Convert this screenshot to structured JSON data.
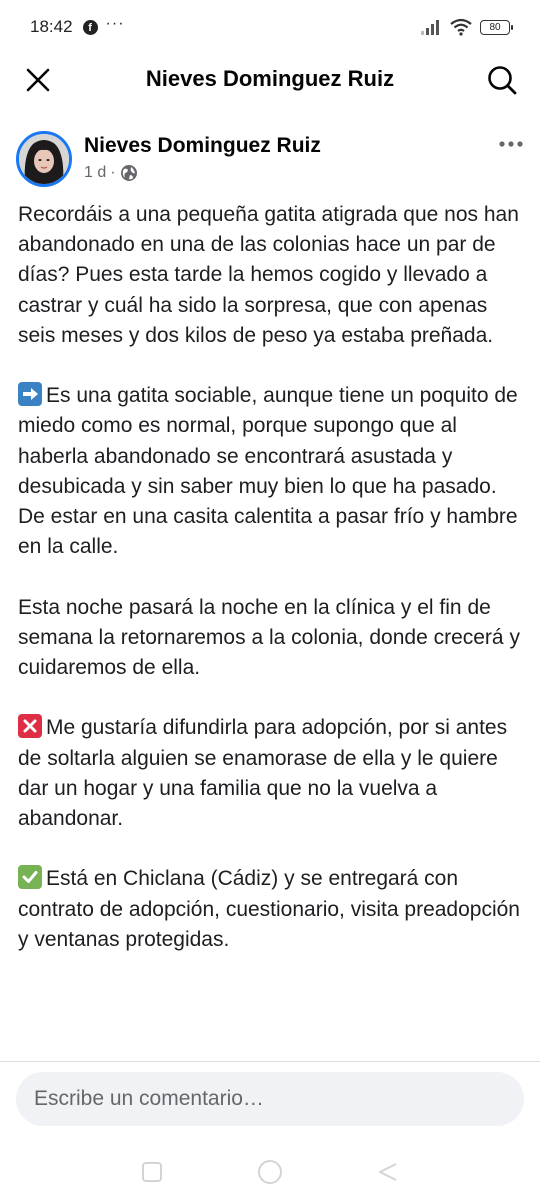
{
  "status_bar": {
    "time": "18:42",
    "facebook_icon": "facebook-icon",
    "more_notifications": "···",
    "battery": "80",
    "icons": [
      "signal-icon",
      "wifi-icon",
      "battery-icon"
    ]
  },
  "header": {
    "title": "Nieves Dominguez Ruiz",
    "close_icon": "close-icon",
    "search_icon": "search-icon"
  },
  "post": {
    "author": "Nieves Dominguez Ruiz",
    "time": "1 d",
    "separator": "·",
    "privacy_icon": "globe-icon",
    "more_icon": "more-options-icon",
    "paragraphs": [
      {
        "emoji": "",
        "text": "Recordáis a una pequeña gatita atigrada que nos han abandonado en una de las colonias hace un par de días? Pues esta tarde la hemos cogido y llevado a castrar y cuál ha sido la sorpresa, que con apenas seis meses y dos kilos de peso ya estaba preñada."
      },
      {
        "emoji": "arrow-right-emoji",
        "text": "Es una gatita sociable, aunque tiene un poquito de miedo como es normal, porque supongo que al haberla abandonado se encontrará asustada y desubicada y sin saber muy bien lo que ha pasado. De estar en una casita calentita a pasar frío y hambre en la calle."
      },
      {
        "emoji": "",
        "text": "Esta noche pasará la noche en la clínica y el fin de semana la retornaremos a la colonia, donde crecerá y cuidaremos de ella."
      },
      {
        "emoji": "cross-mark-emoji",
        "text": "Me gustaría difundirla para adopción, por si antes de soltarla alguien se enamorase de ella y le quiere dar un hogar y una familia que no la vuelva a abandonar."
      },
      {
        "emoji": "check-mark-emoji",
        "text": "Está en Chiclana (Cádiz) y se entregará con contrato de adopción, cuestionario, visita preadopción y ventanas protegidas."
      }
    ]
  },
  "comment": {
    "placeholder": "Escribe un comentario…"
  },
  "nav": {
    "icons": [
      "recent-apps-icon",
      "home-icon",
      "back-icon"
    ]
  },
  "colors": {
    "accent": "#1877f2",
    "text": "#1c1e21",
    "muted": "#65676b",
    "input_bg": "#f0f2f5"
  }
}
